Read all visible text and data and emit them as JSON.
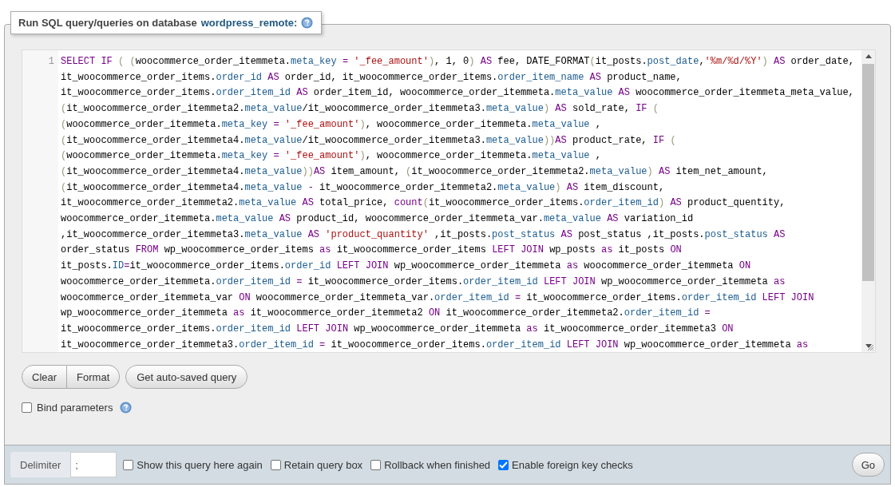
{
  "panel": {
    "title": "Run SQL query/queries on database",
    "database": "wordpress_remote:"
  },
  "editor": {
    "line_number": "1",
    "lines": [
      [
        {
          "text": "SELECT IF ",
          "kind": "kw"
        },
        {
          "text": "( (",
          "kind": "br"
        },
        {
          "text": "woocommerce_order_itemmeta.",
          "kind": "txt"
        },
        {
          "text": "meta_key ",
          "kind": "prop"
        },
        {
          "text": "= ",
          "kind": "kw"
        },
        {
          "text": "'_fee_amount'",
          "kind": "str"
        },
        {
          "text": ")",
          "kind": "br"
        },
        {
          "text": ", 1, 0",
          "kind": "txt"
        },
        {
          "text": ") ",
          "kind": "br"
        },
        {
          "text": "AS",
          "kind": "kw"
        },
        {
          "text": " fee, DATE_FORMAT",
          "kind": "txt"
        },
        {
          "text": "(",
          "kind": "br"
        },
        {
          "text": "it_posts.",
          "kind": "txt"
        },
        {
          "text": "post_date",
          "kind": "prop"
        },
        {
          "text": ",",
          "kind": "txt"
        },
        {
          "text": "'%m/%d/%Y'",
          "kind": "str"
        },
        {
          "text": ") ",
          "kind": "br"
        },
        {
          "text": "AS",
          "kind": "kw"
        },
        {
          "text": " order_date,",
          "kind": "txt"
        }
      ],
      [
        {
          "text": "it_woocommerce_order_items.",
          "kind": "txt"
        },
        {
          "text": "order_id ",
          "kind": "prop"
        },
        {
          "text": "AS",
          "kind": "kw"
        },
        {
          "text": " order_id, it_woocommerce_order_items.",
          "kind": "txt"
        },
        {
          "text": "order_item_name ",
          "kind": "prop"
        },
        {
          "text": "AS",
          "kind": "kw"
        },
        {
          "text": " product_name,",
          "kind": "txt"
        }
      ],
      [
        {
          "text": "it_woocommerce_order_items.",
          "kind": "txt"
        },
        {
          "text": "order_item_id ",
          "kind": "prop"
        },
        {
          "text": "AS",
          "kind": "kw"
        },
        {
          "text": " order_item_id, woocommerce_order_itemmeta.",
          "kind": "txt"
        },
        {
          "text": "meta_value ",
          "kind": "prop"
        },
        {
          "text": "AS",
          "kind": "kw"
        },
        {
          "text": " woocommerce_order_itemmeta_meta_value,",
          "kind": "txt"
        }
      ],
      [
        {
          "text": "(",
          "kind": "br"
        },
        {
          "text": "it_woocommerce_order_itemmeta2.",
          "kind": "txt"
        },
        {
          "text": "meta_value",
          "kind": "prop"
        },
        {
          "text": "/it_woocommerce_order_itemmeta3.",
          "kind": "txt"
        },
        {
          "text": "meta_value",
          "kind": "prop"
        },
        {
          "text": ") ",
          "kind": "br"
        },
        {
          "text": "AS",
          "kind": "kw"
        },
        {
          "text": " sold_rate, ",
          "kind": "txt"
        },
        {
          "text": "IF ",
          "kind": "kw"
        },
        {
          "text": "(",
          "kind": "br"
        }
      ],
      [
        {
          "text": "(",
          "kind": "br"
        },
        {
          "text": "woocommerce_order_itemmeta.",
          "kind": "txt"
        },
        {
          "text": "meta_key ",
          "kind": "prop"
        },
        {
          "text": "= ",
          "kind": "kw"
        },
        {
          "text": "'_fee_amount'",
          "kind": "str"
        },
        {
          "text": ")",
          "kind": "br"
        },
        {
          "text": ", woocommerce_order_itemmeta.",
          "kind": "txt"
        },
        {
          "text": "meta_value",
          "kind": "prop"
        },
        {
          "text": " ,",
          "kind": "txt"
        }
      ],
      [
        {
          "text": "(",
          "kind": "br"
        },
        {
          "text": "it_woocommerce_order_itemmeta4.",
          "kind": "txt"
        },
        {
          "text": "meta_value",
          "kind": "prop"
        },
        {
          "text": "/it_woocommerce_order_itemmeta3.",
          "kind": "txt"
        },
        {
          "text": "meta_value",
          "kind": "prop"
        },
        {
          "text": "))",
          "kind": "br"
        },
        {
          "text": "AS",
          "kind": "kw"
        },
        {
          "text": " product_rate, ",
          "kind": "txt"
        },
        {
          "text": "IF ",
          "kind": "kw"
        },
        {
          "text": "(",
          "kind": "br"
        }
      ],
      [
        {
          "text": "(",
          "kind": "br"
        },
        {
          "text": "woocommerce_order_itemmeta.",
          "kind": "txt"
        },
        {
          "text": "meta_key ",
          "kind": "prop"
        },
        {
          "text": "= ",
          "kind": "kw"
        },
        {
          "text": "'_fee_amount'",
          "kind": "str"
        },
        {
          "text": ")",
          "kind": "br"
        },
        {
          "text": ", woocommerce_order_itemmeta.",
          "kind": "txt"
        },
        {
          "text": "meta_value",
          "kind": "prop"
        },
        {
          "text": " ,",
          "kind": "txt"
        }
      ],
      [
        {
          "text": "(",
          "kind": "br"
        },
        {
          "text": "it_woocommerce_order_itemmeta4.",
          "kind": "txt"
        },
        {
          "text": "meta_value",
          "kind": "prop"
        },
        {
          "text": "))",
          "kind": "br"
        },
        {
          "text": "AS",
          "kind": "kw"
        },
        {
          "text": " item_amount, ",
          "kind": "txt"
        },
        {
          "text": "(",
          "kind": "br"
        },
        {
          "text": "it_woocommerce_order_itemmeta2.",
          "kind": "txt"
        },
        {
          "text": "meta_value",
          "kind": "prop"
        },
        {
          "text": ") ",
          "kind": "br"
        },
        {
          "text": "AS",
          "kind": "kw"
        },
        {
          "text": " item_net_amount,",
          "kind": "txt"
        }
      ],
      [
        {
          "text": "(",
          "kind": "br"
        },
        {
          "text": "it_woocommerce_order_itemmeta4.",
          "kind": "txt"
        },
        {
          "text": "meta_value ",
          "kind": "prop"
        },
        {
          "text": "-",
          "kind": "kw"
        },
        {
          "text": " it_woocommerce_order_itemmeta2.",
          "kind": "txt"
        },
        {
          "text": "meta_value",
          "kind": "prop"
        },
        {
          "text": ") ",
          "kind": "br"
        },
        {
          "text": "AS",
          "kind": "kw"
        },
        {
          "text": " item_discount,",
          "kind": "txt"
        }
      ],
      [
        {
          "text": "it_woocommerce_order_itemmeta2.",
          "kind": "txt"
        },
        {
          "text": "meta_value ",
          "kind": "prop"
        },
        {
          "text": "AS",
          "kind": "kw"
        },
        {
          "text": " total_price, ",
          "kind": "txt"
        },
        {
          "text": "count",
          "kind": "kw"
        },
        {
          "text": "(",
          "kind": "br"
        },
        {
          "text": "it_woocommerce_order_items.",
          "kind": "txt"
        },
        {
          "text": "order_item_id",
          "kind": "prop"
        },
        {
          "text": ") ",
          "kind": "br"
        },
        {
          "text": "AS",
          "kind": "kw"
        },
        {
          "text": " product_quentity,",
          "kind": "txt"
        }
      ],
      [
        {
          "text": "woocommerce_order_itemmeta.",
          "kind": "txt"
        },
        {
          "text": "meta_value ",
          "kind": "prop"
        },
        {
          "text": "AS",
          "kind": "kw"
        },
        {
          "text": " product_id, woocommerce_order_itemmeta_var.",
          "kind": "txt"
        },
        {
          "text": "meta_value ",
          "kind": "prop"
        },
        {
          "text": "AS",
          "kind": "kw"
        },
        {
          "text": " variation_id",
          "kind": "txt"
        }
      ],
      [
        {
          "text": ",it_woocommerce_order_itemmeta3.",
          "kind": "txt"
        },
        {
          "text": "meta_value ",
          "kind": "prop"
        },
        {
          "text": "AS ",
          "kind": "kw"
        },
        {
          "text": "'product_quantity'",
          "kind": "str"
        },
        {
          "text": " ,it_posts.",
          "kind": "txt"
        },
        {
          "text": "post_status ",
          "kind": "prop"
        },
        {
          "text": "AS",
          "kind": "kw"
        },
        {
          "text": " post_status ,it_posts.",
          "kind": "txt"
        },
        {
          "text": "post_status ",
          "kind": "prop"
        },
        {
          "text": "AS",
          "kind": "kw"
        }
      ],
      [
        {
          "text": "order_status ",
          "kind": "txt"
        },
        {
          "text": "FROM",
          "kind": "kw"
        },
        {
          "text": " wp_woocommerce_order_items ",
          "kind": "txt"
        },
        {
          "text": "as",
          "kind": "kw"
        },
        {
          "text": " it_woocommerce_order_items ",
          "kind": "txt"
        },
        {
          "text": "LEFT JOIN",
          "kind": "kw"
        },
        {
          "text": " wp_posts ",
          "kind": "txt"
        },
        {
          "text": "as",
          "kind": "kw"
        },
        {
          "text": " it_posts ",
          "kind": "txt"
        },
        {
          "text": "ON",
          "kind": "kw"
        }
      ],
      [
        {
          "text": "it_posts.",
          "kind": "txt"
        },
        {
          "text": "ID",
          "kind": "prop"
        },
        {
          "text": "=",
          "kind": "kw"
        },
        {
          "text": "it_woocommerce_order_items.",
          "kind": "txt"
        },
        {
          "text": "order_id ",
          "kind": "prop"
        },
        {
          "text": "LEFT JOIN",
          "kind": "kw"
        },
        {
          "text": " wp_woocommerce_order_itemmeta ",
          "kind": "txt"
        },
        {
          "text": "as",
          "kind": "kw"
        },
        {
          "text": " woocommerce_order_itemmeta ",
          "kind": "txt"
        },
        {
          "text": "ON",
          "kind": "kw"
        }
      ],
      [
        {
          "text": "woocommerce_order_itemmeta.",
          "kind": "txt"
        },
        {
          "text": "order_item_id ",
          "kind": "prop"
        },
        {
          "text": "=",
          "kind": "kw"
        },
        {
          "text": " it_woocommerce_order_items.",
          "kind": "txt"
        },
        {
          "text": "order_item_id ",
          "kind": "prop"
        },
        {
          "text": "LEFT JOIN",
          "kind": "kw"
        },
        {
          "text": " wp_woocommerce_order_itemmeta ",
          "kind": "txt"
        },
        {
          "text": "as",
          "kind": "kw"
        }
      ],
      [
        {
          "text": "woocommerce_order_itemmeta_var ",
          "kind": "txt"
        },
        {
          "text": "ON",
          "kind": "kw"
        },
        {
          "text": " woocommerce_order_itemmeta_var.",
          "kind": "txt"
        },
        {
          "text": "order_item_id ",
          "kind": "prop"
        },
        {
          "text": "=",
          "kind": "kw"
        },
        {
          "text": " it_woocommerce_order_items.",
          "kind": "txt"
        },
        {
          "text": "order_item_id ",
          "kind": "prop"
        },
        {
          "text": "LEFT JOIN",
          "kind": "kw"
        }
      ],
      [
        {
          "text": "wp_woocommerce_order_itemmeta ",
          "kind": "txt"
        },
        {
          "text": "as",
          "kind": "kw"
        },
        {
          "text": " it_woocommerce_order_itemmeta2 ",
          "kind": "txt"
        },
        {
          "text": "ON",
          "kind": "kw"
        },
        {
          "text": " it_woocommerce_order_itemmeta2.",
          "kind": "txt"
        },
        {
          "text": "order_item_id ",
          "kind": "prop"
        },
        {
          "text": "=",
          "kind": "kw"
        }
      ],
      [
        {
          "text": "it_woocommerce_order_items.",
          "kind": "txt"
        },
        {
          "text": "order_item_id ",
          "kind": "prop"
        },
        {
          "text": "LEFT JOIN",
          "kind": "kw"
        },
        {
          "text": " wp_woocommerce_order_itemmeta ",
          "kind": "txt"
        },
        {
          "text": "as",
          "kind": "kw"
        },
        {
          "text": " it_woocommerce_order_itemmeta3 ",
          "kind": "txt"
        },
        {
          "text": "ON",
          "kind": "kw"
        }
      ],
      [
        {
          "text": "it_woocommerce_order_itemmeta3.",
          "kind": "txt"
        },
        {
          "text": "order_item_id ",
          "kind": "prop"
        },
        {
          "text": "=",
          "kind": "kw"
        },
        {
          "text": " it_woocommerce_order_items.",
          "kind": "txt"
        },
        {
          "text": "order_item_id ",
          "kind": "prop"
        },
        {
          "text": "LEFT JOIN",
          "kind": "kw"
        },
        {
          "text": " wp_woocommerce_order_itemmeta ",
          "kind": "txt"
        },
        {
          "text": "as",
          "kind": "kw"
        }
      ]
    ]
  },
  "button_group": [
    "Clear",
    "Format"
  ],
  "auto_saved_button": "Get auto-saved query",
  "bind_parameters": {
    "label": "Bind parameters",
    "checked": false
  },
  "footer": {
    "delimiter_label": "Delimiter",
    "delimiter_value": ";",
    "options": [
      {
        "label": "Show this query here again",
        "checked": false
      },
      {
        "label": "Retain query box",
        "checked": false
      },
      {
        "label": "Rollback when finished",
        "checked": false
      },
      {
        "label": "Enable foreign key checks",
        "checked": true
      }
    ],
    "go": "Go"
  }
}
